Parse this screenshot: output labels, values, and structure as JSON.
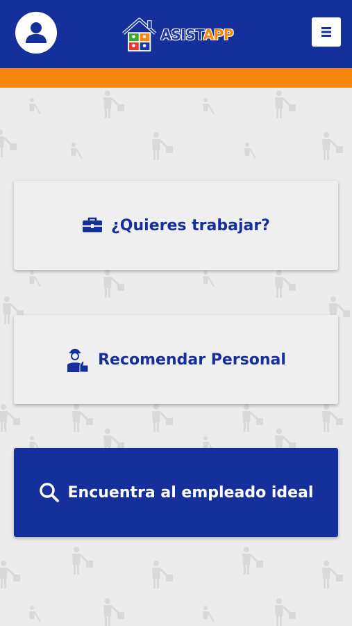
{
  "header": {
    "logo": {
      "part1": "ASIST",
      "part2": "APP"
    },
    "icons": {
      "profile": "user-icon",
      "menu": "hamburger-icon"
    }
  },
  "actions": [
    {
      "label": "¿Quieres trabajar?",
      "icon": "briefcase-icon"
    },
    {
      "label": "Recomendar Personal",
      "icon": "worker-thumbs-up-icon"
    },
    {
      "label": "Encuentra al empleado ideal",
      "icon": "search-icon"
    }
  ],
  "colors": {
    "primary": "#15309a",
    "accent": "#f5870f",
    "background": "#ececec"
  }
}
